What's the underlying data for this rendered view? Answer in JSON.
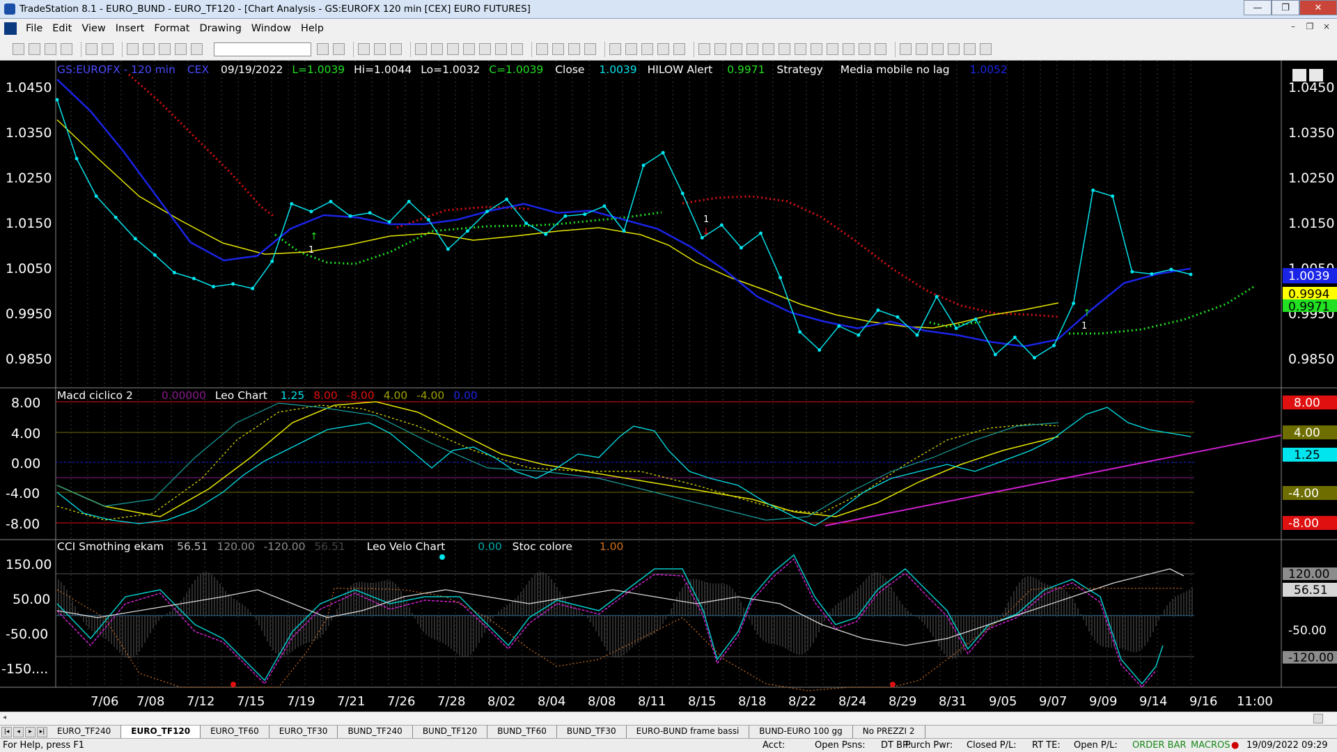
{
  "window_title": "TradeStation 8.1 - EURO_BUND - EURO_TF120 - [Chart Analysis - GS:EUROFX  120 min  [CEX] EURO FUTURES]",
  "window_buttons": [
    "—",
    "❐",
    "✕"
  ],
  "mdi_buttons": [
    "–",
    "❐",
    "×"
  ],
  "menu": [
    "File",
    "Edit",
    "View",
    "Insert",
    "Format",
    "Drawing",
    "Window",
    "Help"
  ],
  "chart": {
    "price_header": {
      "symbol": "GS:EUROFX - 120 min",
      "exchange": "CEX",
      "date": "09/19/2022",
      "last": "L=1.0039",
      "high": "Hi=1.0044",
      "low": "Lo=1.0032",
      "close_c": "C=1.0039",
      "close_label": "Close",
      "close_value": "1.0039",
      "hilow_label": "HILOW Alert",
      "hilow_value": "0.9971",
      "strategy_label": "Strategy",
      "ma_label": "Media mobile no lag",
      "ma_value": "1.0052"
    },
    "macd_header": {
      "name": "Macd ciclico 2",
      "value1": "0.00000",
      "leo": "Leo Chart",
      "v125": "1.25",
      "v8": "8.00",
      "vm8": "-8.00",
      "v4": "4.00",
      "vm4": "-4.00",
      "v0": "0.00"
    },
    "cci_header": {
      "name": "CCI Smothing ekam",
      "v1": "56.51",
      "v2": "120.00",
      "v3": "-120.00",
      "v4": "56.51",
      "leo_velo": "Leo Velo Chart",
      "velo_value": "0.00",
      "stoc": "Stoc colore",
      "stoc_value": "1.00"
    },
    "price_axis_left": [
      "1.0450",
      "1.0350",
      "1.0250",
      "1.0150",
      "1.0050",
      "0.9950",
      "0.9850"
    ],
    "price_axis_right": [
      "1.0450",
      "1.0350",
      "1.0250",
      "1.0150",
      "1.0050",
      "0.9950",
      "0.9850"
    ],
    "price_tags": [
      {
        "text": "1.0039",
        "bg": "#1a24e6",
        "fg": "#ffffff"
      },
      {
        "text": "0.9994",
        "bg": "#ffff00",
        "fg": "#000000"
      },
      {
        "text": "0.9971",
        "bg": "#22e022",
        "fg": "#000000"
      }
    ],
    "macd_axis_left": [
      "8.00",
      "4.00",
      "0.00",
      "-4.00",
      "-8.00"
    ],
    "macd_tags": [
      {
        "text": "8.00",
        "bg": "#e01010",
        "fg": "#ffffff"
      },
      {
        "text": "4.00",
        "bg": "#6e6e00",
        "fg": "#ffffff"
      },
      {
        "text": "1.25",
        "bg": "#00e5ee",
        "fg": "#000000"
      },
      {
        "text": "-4.00",
        "bg": "#6e6e00",
        "fg": "#ffffff"
      },
      {
        "text": "-8.00",
        "bg": "#e01010",
        "fg": "#ffffff"
      }
    ],
    "cci_axis_left": [
      "150.00",
      "50.00",
      "-50.00",
      "-150...."
    ],
    "cci_tags": [
      {
        "text": "120.00",
        "bg": "#8c8c8c",
        "fg": "#000000"
      },
      {
        "text": "56.51",
        "bg": "#d6d6d6",
        "fg": "#000000"
      },
      {
        "text": "-50.00",
        "bg": "#000000",
        "fg": "#ffffff"
      },
      {
        "text": "-120.00",
        "bg": "#8c8c8c",
        "fg": "#000000"
      }
    ],
    "time_axis": [
      "7/06",
      "7/08",
      "7/12",
      "7/15",
      "7/19",
      "7/21",
      "7/26",
      "7/28",
      "8/02",
      "8/04",
      "8/08",
      "8/11",
      "8/15",
      "8/18",
      "8/22",
      "8/24",
      "8/29",
      "8/31",
      "9/05",
      "9/07",
      "9/09",
      "9/14",
      "9/16",
      "11:00"
    ],
    "signal_labels": [
      "1",
      "1",
      "1"
    ],
    "price_series": {
      "close": [
        1.0425,
        1.0295,
        1.0212,
        1.0165,
        1.0118,
        1.0082,
        1.0043,
        1.003,
        1.0012,
        1.0018,
        1.0008,
        1.0068,
        1.0195,
        1.0178,
        1.02,
        1.0168,
        1.0175,
        1.0155,
        1.02,
        1.016,
        1.0095,
        1.0135,
        1.0178,
        1.0205,
        1.0152,
        1.0128,
        1.0168,
        1.0172,
        1.019,
        1.0135,
        1.028,
        1.0308,
        1.0218,
        1.012,
        1.0148,
        1.0098,
        1.013,
        1.0032,
        0.9912,
        0.9872,
        0.9925,
        0.9905,
        0.996,
        0.9945,
        0.9905,
        0.999,
        0.992,
        0.994,
        0.9862,
        0.99,
        0.9855,
        0.9882,
        0.9975,
        1.0225,
        1.0212,
        1.0045,
        1.004,
        1.005,
        1.0039
      ],
      "ma": [
        1.047,
        1.04,
        1.031,
        1.021,
        1.011,
        1.007,
        1.008,
        1.014,
        1.017,
        1.0165,
        1.015,
        1.015,
        1.016,
        1.018,
        1.0195,
        1.0175,
        1.018,
        1.016,
        1.014,
        1.01,
        1.005,
        0.999,
        0.9955,
        0.9935,
        0.992,
        0.9935,
        0.9915,
        0.9905,
        0.989,
        0.988,
        0.9895,
        0.996,
        1.002,
        1.004,
        1.0052
      ]
    },
    "band": {
      "top": "#e01010",
      "mid": "#00ccdd",
      "sub": "#6e6e00"
    },
    "colors": {
      "close": "#00e5ee",
      "ma": "#1a24e6",
      "avg": "#e6e600",
      "trail_up": "#22e022",
      "trail_down": "#e01010",
      "trend": "#d020d0"
    }
  },
  "tabs": [
    "EURO_TF240",
    "EURO_TF120",
    "EURO_TF60",
    "EURO_TF30",
    "BUND_TF240",
    "BUND_TF120",
    "BUND_TF60",
    "BUND_TF30",
    "EURO-BUND frame bassi",
    "BUND-EURO 100 gg",
    "No PREZZI 2"
  ],
  "active_tab": 1,
  "status": {
    "help": "For Help, press F1",
    "acct": "Acct:",
    "open_psns": "Open Psns:",
    "dt_bp": "DT BP:",
    "purch_pwr": "Purch Pwr:",
    "closed_pl": "Closed P/L:",
    "rt_te": "RT TE:",
    "open_pl": "Open P/L:",
    "order_bar": "ORDER BAR",
    "macros": "MACROS",
    "datetime": "19/09/2022 09:29"
  }
}
